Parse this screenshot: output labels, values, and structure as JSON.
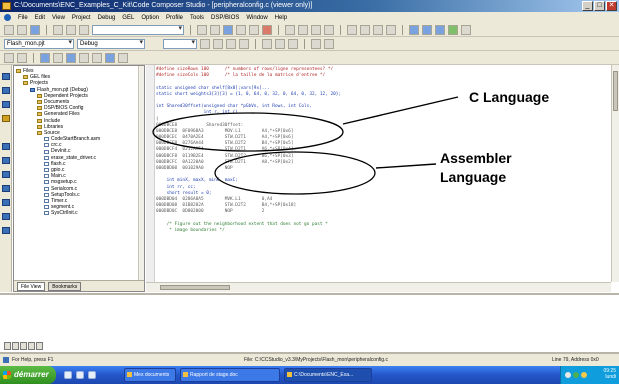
{
  "window": {
    "title": "C:\\Documents\\ENC_Examples_C_Kit\\Code Composer Studio - [peripheralconfig.c (viewer only)]",
    "buttons": {
      "minimize": "_",
      "maximize": "□",
      "close": "✕"
    }
  },
  "menu": [
    "File",
    "Edit",
    "View",
    "Project",
    "Debug",
    "GEL",
    "Option",
    "Profile",
    "Tools",
    "DSP/BIOS",
    "Window",
    "Help"
  ],
  "toolbar": {
    "project_combo": "Flash_mon.pjt",
    "config_combo": "Debug"
  },
  "file_tree": {
    "items": [
      {
        "label": "Files",
        "indent": 0,
        "kind": "folder"
      },
      {
        "label": "GEL files",
        "indent": 1,
        "kind": "folder"
      },
      {
        "label": "Projects",
        "indent": 1,
        "kind": "folder"
      },
      {
        "label": "Flash_mon.pjt (Debug)",
        "indent": 2,
        "kind": "proj"
      },
      {
        "label": "Dependent Projects",
        "indent": 3,
        "kind": "folder"
      },
      {
        "label": "Documents",
        "indent": 3,
        "kind": "folder"
      },
      {
        "label": "DSP/BIOS Config",
        "indent": 3,
        "kind": "folder"
      },
      {
        "label": "Generated Files",
        "indent": 3,
        "kind": "folder"
      },
      {
        "label": "Include",
        "indent": 3,
        "kind": "folder"
      },
      {
        "label": "Libraries",
        "indent": 3,
        "kind": "folder"
      },
      {
        "label": "Source",
        "indent": 3,
        "kind": "folder"
      },
      {
        "label": "CodeStartBranch.asm",
        "indent": 4,
        "kind": "file"
      },
      {
        "label": "crc.c",
        "indent": 4,
        "kind": "file"
      },
      {
        "label": "DevInit.c",
        "indent": 4,
        "kind": "file"
      },
      {
        "label": "erase_state_driver.c",
        "indent": 4,
        "kind": "file"
      },
      {
        "label": "flash.c",
        "indent": 4,
        "kind": "file"
      },
      {
        "label": "gpio.c",
        "indent": 4,
        "kind": "file"
      },
      {
        "label": "Main.c",
        "indent": 4,
        "kind": "file"
      },
      {
        "label": "msgsetup.c",
        "indent": 4,
        "kind": "file"
      },
      {
        "label": "Serialcom.c",
        "indent": 4,
        "kind": "file"
      },
      {
        "label": "SetupTools.c",
        "indent": 4,
        "kind": "file"
      },
      {
        "label": "Timer.c",
        "indent": 4,
        "kind": "file"
      },
      {
        "label": "segment.c",
        "indent": 4,
        "kind": "file"
      },
      {
        "label": "SysCtrlInit.c",
        "indent": 4,
        "kind": "file"
      }
    ],
    "tabs": {
      "file_view": "File View",
      "bookmarks": "Bookmarks"
    }
  },
  "code": {
    "lines": [
      {
        "text": "#define sizeRows 100      /* numbers of rows/ligne representees? */",
        "style": "c-red"
      },
      {
        "text": "#define sizeCols 100      /* la taille de la matrice d'entree */",
        "style": "c-red"
      },
      {
        "text": "",
        "style": ""
      },
      {
        "text": "static unsigned char shelf[8x8];vars[9x]...",
        "style": "c-blue"
      },
      {
        "text": "static short weights3[3][3] = {1, 0, 64, 0, 32, 0, 64, 0, 32, 12, 20};",
        "style": "c-blue"
      },
      {
        "text": "",
        "style": ""
      },
      {
        "text": "int Shared30ffset(unsigned char *pGbVn, int Rows, int Cols,",
        "style": "c-blue"
      },
      {
        "text": "                  int r, int c)",
        "style": "c-blue"
      },
      {
        "text": "{",
        "style": "c-gray"
      },
      {
        "text": "000DBCE8           Shared30ffset:",
        "style": "c-gray"
      },
      {
        "text": "000DBCE8  0F0968A3        MOV.L1        A4,*+SP[0x6]",
        "style": "c-gray"
      },
      {
        "text": "000DBCEC  0470A2E4        STW.D2T1      A4,*+SP[0x6]",
        "style": "c-gray"
      },
      {
        "text": "000DBCF0  0276AA44        STW.D2T2      B4,*+SP[0x5]",
        "style": "c-gray"
      },
      {
        "text": "000DBCF4  0212AA54        STW.D2T1      A6,*+SP[0x4]",
        "style": "c-gray"
      },
      {
        "text": "000DBCF8  0119B2E4        STW.D2T2      B6,*+SP[0x3]",
        "style": "c-gray"
      },
      {
        "text": "000DBCFC  0A1220A0        STW.D2T1      A8,*+SP[0x2]",
        "style": "c-gray"
      },
      {
        "text": "000DBD00  001029A0        NOP",
        "style": "c-gray"
      },
      {
        "text": "",
        "style": ""
      },
      {
        "text": "    int minX, maxX, minC, maxC;",
        "style": "c-blue"
      },
      {
        "text": "    int rr, cc;",
        "style": "c-blue"
      },
      {
        "text": "    short result = 0;",
        "style": "c-blue"
      },
      {
        "text": "000DBD04  0286A8A5        MVK.L1        0,A4",
        "style": "c-gray"
      },
      {
        "text": "000DBD08  01B8282A        STW.D2T2      B4,*+SP[0x18]",
        "style": "c-gray"
      },
      {
        "text": "000DBD0C  0D802000        NOP           2",
        "style": "c-gray"
      },
      {
        "text": "",
        "style": ""
      },
      {
        "text": "    /* Figure out the neighborhood extent that does not go past *",
        "style": "c-green"
      },
      {
        "text": "     * image boundaries */",
        "style": "c-green"
      }
    ]
  },
  "annotations": {
    "c_language": "C Language",
    "assembler_line1": "Assembler",
    "assembler_line2": "Language",
    "colors": {
      "ink": "#000000"
    }
  },
  "status": {
    "left": "For Help, press F1",
    "middle": "File: C:\\CCStudio_v3.3\\MyProjects\\Flash_mon\\peripheralconfig.c",
    "right": "Line 79, Address 0x0"
  },
  "taskbar": {
    "start": "démarrer",
    "tasks": [
      {
        "label": "Mes documents"
      },
      {
        "label": "Rapport de stage.doc"
      },
      {
        "label": "C:\\Documents\\ENC_Exa..."
      }
    ],
    "clock_time": "09:25",
    "clock_day": "lundi"
  },
  "colors": {
    "title_gradient_start": "#0a246a",
    "chrome": "#ece9d8",
    "taskbar": "#2456c8",
    "start_green": "#3fa02a"
  }
}
